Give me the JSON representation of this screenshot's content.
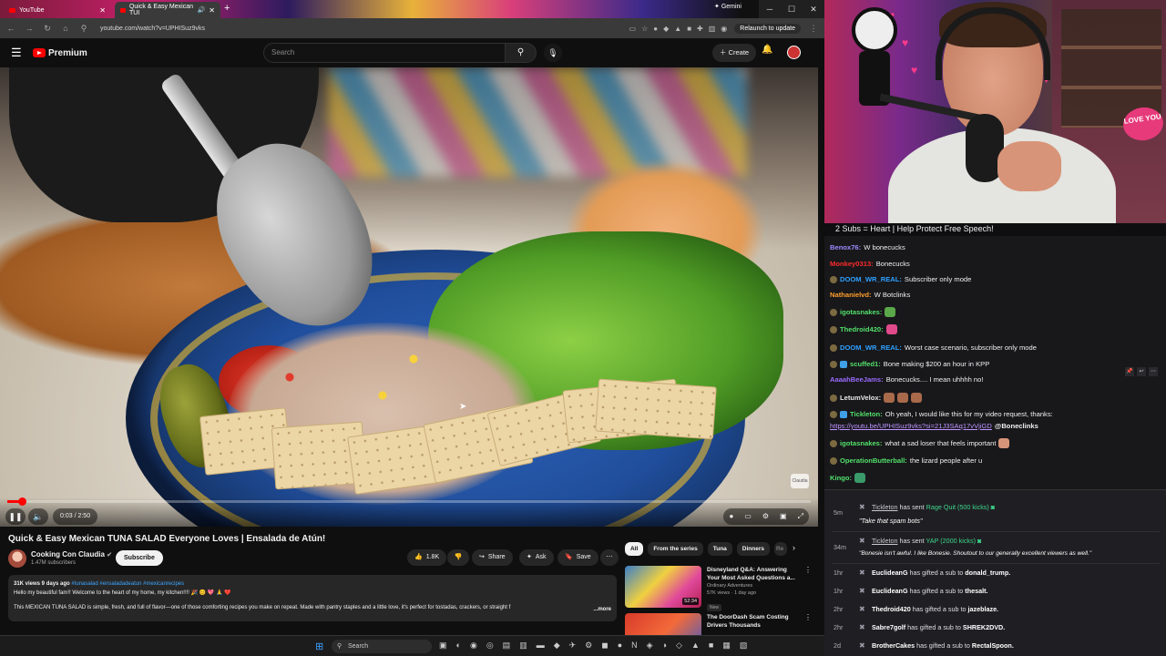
{
  "browser": {
    "tabs": [
      {
        "title": "YouTube"
      },
      {
        "title": "Quick & Easy Mexican TUI"
      }
    ],
    "right_tab": "Gemini",
    "url": "youtube.com/watch?v=UPHISuz9vks",
    "relaunch": "Relaunch to update"
  },
  "youtube": {
    "logo_text": "Premium",
    "search_placeholder": "Search",
    "create_label": "Create"
  },
  "player": {
    "time": "0:03 / 2:50",
    "progress": 0.018,
    "watermark": "Claudia"
  },
  "video": {
    "title": "Quick & Easy Mexican TUNA SALAD Everyone Loves | Ensalada de Atún!",
    "channel": "Cooking Con Claudia",
    "subscribers": "1.47M subscribers",
    "subscribe_label": "Subscribe",
    "likes": "1.8K",
    "share_label": "Share",
    "ask_label": "Ask",
    "save_label": "Save",
    "desc_meta": "31K views  9 days ago ",
    "desc_tags": "#tunasalad #ensaladadeatun #mexicanrecipes",
    "desc_line1": "Hello my beautiful fam!! Welcome to the heart of my home, my kitchen!!!! 🎉 😊 💖 🙏 ❤️",
    "desc_line2": "This MEXICAN TUNA SALAD is simple, fresh, and full of flavor—one of those comforting recipes you make on repeat. Made with pantry staples and a little love, it's perfect for tostadas, crackers, or straight f",
    "desc_more": "...more"
  },
  "chips": [
    "All",
    "From the series",
    "Tuna",
    "Dinners",
    "Re"
  ],
  "recommended": [
    {
      "title_1": "Disneyland Q&A: Answering",
      "title_2": "Your Most Asked Questions a...",
      "channel": "Ordinary Adventures",
      "meta": "57K views · 1 day ago",
      "badge": "New",
      "duration": "52:34"
    },
    {
      "title_1": "The DoorDash Scam Costing",
      "title_2": "Drivers Thousands",
      "channel": "",
      "meta": "",
      "badge": "",
      "duration": ""
    }
  ],
  "taskbar": {
    "search": "Search"
  },
  "cam": {
    "sign": "LOVE YOU"
  },
  "chat": {
    "banner": "2 Subs = Heart | Help Protect Free Speech!",
    "messages": [
      {
        "user": "Benox76:",
        "color": "#9b8cff",
        "text": "W bonecucks"
      },
      {
        "user": "Monkey0313:",
        "color": "#ff2a2a",
        "text": "Bonecucks"
      },
      {
        "user": "DOOM_WR_REAL:",
        "color": "#2ea1ff",
        "text": "Subscriber only mode"
      },
      {
        "user": "Nathanielvd:",
        "color": "#ff9e2c",
        "text": "W Botclinks"
      },
      {
        "user": "igotasnakes:",
        "color": "#52e06a",
        "text": ""
      },
      {
        "user": "Thedroid420:",
        "color": "#52e06a",
        "text": ""
      },
      {
        "user": "DOOM_WR_REAL:",
        "color": "#2ea1ff",
        "text": "Worst case scenario, subscriber only mode"
      },
      {
        "user": "scuffed1:",
        "color": "#52e06a",
        "text": "Bone making $200 an hour in KPP"
      },
      {
        "user": "AaaahBeeJams:",
        "color": "#9b6bff",
        "text": "Bonecucks.... I mean uhhhh no!"
      },
      {
        "user": "LetumVelox:",
        "color": "#e8e8e8",
        "text": ""
      },
      {
        "user": "Tickleton:",
        "color": "#52e06a",
        "text": "Oh yeah, I would like this for my video request, thanks:"
      },
      {
        "user": "",
        "color": "#efeff1",
        "text": "https://youtu.be/UPHISuz9vks?si=21J3SAq17vVjiGD",
        "extra": "@Boneclinks"
      },
      {
        "user": "igotasnakes:",
        "color": "#52e06a",
        "text": "what a sad loser that feels important"
      },
      {
        "user": "OperationButterball:",
        "color": "#52e06a",
        "text": "the lizard people after u"
      },
      {
        "user": "Kingo:",
        "color": "#52e06a",
        "text": ""
      }
    ]
  },
  "events": [
    {
      "age": "5m",
      "user": "Tickleton",
      "mid": "has sent",
      "item": "Rage Quit (500 kicks)",
      "quote": "\"Take that spam bots\""
    },
    {
      "age": "34m",
      "user": "Tickleton",
      "mid": "has sent",
      "item": "YAP (2000 kicks)",
      "quote": "\"Bonesie isn't awful. I like Bonesie. Shoutout to our generally excellent viewers as well.\""
    },
    {
      "age": "1hr",
      "user": "EuclideanG",
      "mid": "has gifted a sub to",
      "item": "donald_trump.",
      "quote": ""
    },
    {
      "age": "1hr",
      "user": "EuclideanG",
      "mid": "has gifted a sub to",
      "item": "thesalt.",
      "quote": ""
    },
    {
      "age": "2hr",
      "user": "Thedroid420",
      "mid": "has gifted a sub to",
      "item": "jazeblaze.",
      "quote": ""
    },
    {
      "age": "2hr",
      "user": "Sabre7golf",
      "mid": "has gifted a sub to",
      "item": "SHREK2DVD.",
      "quote": ""
    },
    {
      "age": "2d",
      "user": "BrotherCakes",
      "mid": "has gifted a sub to",
      "item": "RectalSpoon.",
      "quote": ""
    }
  ]
}
